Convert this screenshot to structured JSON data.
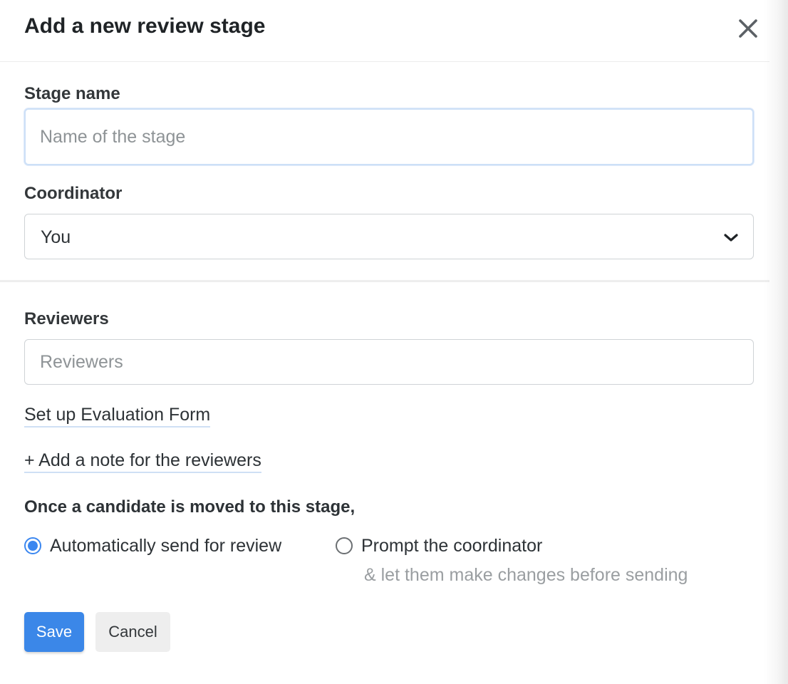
{
  "dialog": {
    "title": "Add a new review stage",
    "close_icon": "close-icon"
  },
  "stage_name": {
    "label": "Stage name",
    "value": "",
    "placeholder": "Name of the stage"
  },
  "coordinator": {
    "label": "Coordinator",
    "selected": "You",
    "icon": "chevron-down-icon"
  },
  "reviewers": {
    "label": "Reviewers",
    "value": "",
    "placeholder": "Reviewers"
  },
  "links": {
    "evaluation_form": "Set up Evaluation Form",
    "add_note": "+ Add a note for the reviewers"
  },
  "trigger": {
    "question": "Once a candidate is moved to this stage,",
    "options": [
      {
        "label": "Automatically send for review",
        "checked": true
      },
      {
        "label": "Prompt the coordinator",
        "sublabel": "& let them make changes before sending",
        "checked": false
      }
    ]
  },
  "actions": {
    "save_label": "Save",
    "cancel_label": "Cancel"
  },
  "colors": {
    "primary": "#3b87e8",
    "radio_checked": "#3b87f0",
    "link_underline": "#cfe0f5"
  }
}
